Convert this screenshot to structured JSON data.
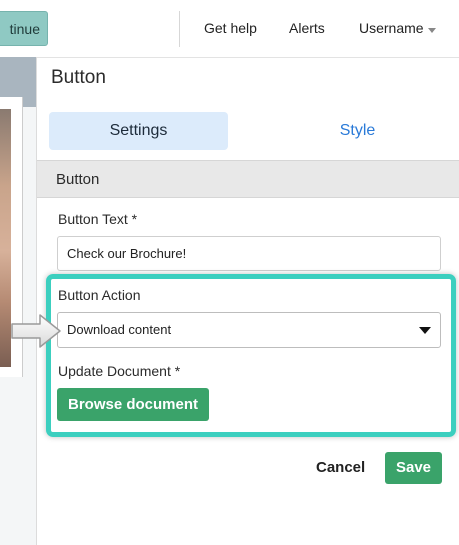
{
  "topbar": {
    "continue_label": "tinue",
    "help_label": "Get help",
    "alerts_label": "Alerts",
    "user_label": "Username"
  },
  "panel": {
    "title": "Button",
    "tabs": [
      {
        "label": "Settings",
        "active": true
      },
      {
        "label": "Style",
        "active": false
      }
    ],
    "section_title": "Button",
    "fields": {
      "button_text": {
        "label": "Button Text *",
        "value": "Check our Brochure!"
      },
      "button_action": {
        "label": "Button Action",
        "selected": "Download content"
      },
      "update_document": {
        "label": "Update Document *",
        "button_label": "Browse document"
      }
    },
    "actions": {
      "cancel_label": "Cancel",
      "save_label": "Save"
    }
  },
  "colors": {
    "accent_green": "#3aa36a",
    "highlight_teal": "#3ccfbf",
    "tab_active_bg": "#dcebfb",
    "tab_link": "#2a7ad8"
  },
  "icons": {
    "dropdown": "caret-down-icon",
    "user_menu": "caret-down-icon",
    "pointer": "arrow-right-icon"
  }
}
